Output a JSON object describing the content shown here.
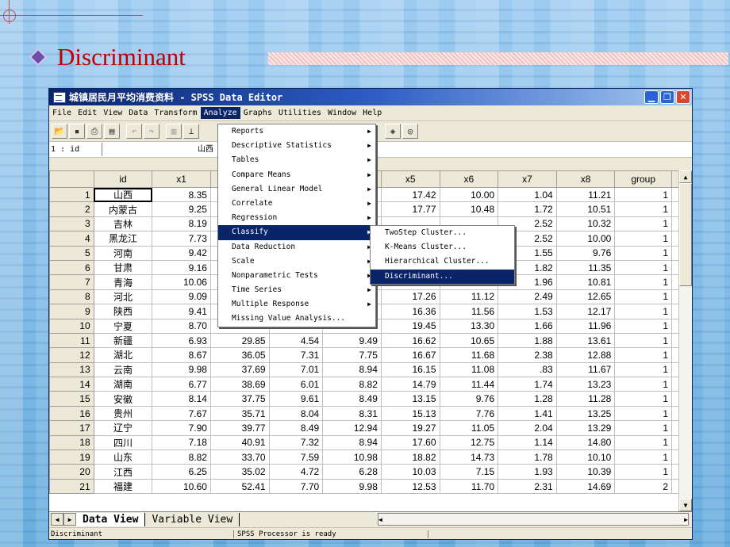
{
  "slide": {
    "title": "Discriminant"
  },
  "window": {
    "title": "城镇居民月平均消费资料 - SPSS Data Editor",
    "buttons": {
      "minimize": "▁",
      "maximize": "❐",
      "close": "✕"
    }
  },
  "menubar": [
    "File",
    "Edit",
    "View",
    "Data",
    "Transform",
    "Analyze",
    "Graphs",
    "Utilities",
    "Window",
    "Help"
  ],
  "cell_ref": {
    "address": "1 : id",
    "value": "山西"
  },
  "columns": [
    "id",
    "x1",
    "x2",
    "x3",
    "x4",
    "x5",
    "x6",
    "x7",
    "x8",
    "group"
  ],
  "rows": [
    {
      "n": "1",
      "id": "山西",
      "x1": "8.35",
      "x2": "",
      "x3": "",
      "x4": "",
      "x5": "17.42",
      "x6": "10.00",
      "x7": "1.04",
      "x8": "11.21",
      "group": "1"
    },
    {
      "n": "2",
      "id": "内蒙古",
      "x1": "9.25",
      "x2": "",
      "x3": "",
      "x4": "",
      "x5": "17.77",
      "x6": "10.48",
      "x7": "1.72",
      "x8": "10.51",
      "group": "1"
    },
    {
      "n": "3",
      "id": "吉林",
      "x1": "8.19",
      "x2": "",
      "x3": "",
      "x4": "",
      "x5": "",
      "x6": "",
      "x7": "2.52",
      "x8": "10.32",
      "group": "1"
    },
    {
      "n": "4",
      "id": "黑龙江",
      "x1": "7.73",
      "x2": "",
      "x3": "",
      "x4": "",
      "x5": "",
      "x6": "",
      "x7": "2.52",
      "x8": "10.00",
      "group": "1"
    },
    {
      "n": "5",
      "id": "河南",
      "x1": "9.42",
      "x2": "",
      "x3": "",
      "x4": "",
      "x5": "",
      "x6": "",
      "x7": "1.55",
      "x8": "9.76",
      "group": "1"
    },
    {
      "n": "6",
      "id": "甘肃",
      "x1": "9.16",
      "x2": "",
      "x3": "",
      "x4": "",
      "x5": "",
      "x6": "",
      "x7": "1.82",
      "x8": "11.35",
      "group": "1"
    },
    {
      "n": "7",
      "id": "青海",
      "x1": "10.06",
      "x2": "",
      "x3": "",
      "x4": "",
      "x5": "",
      "x6": "",
      "x7": "1.96",
      "x8": "10.81",
      "group": "1"
    },
    {
      "n": "8",
      "id": "河北",
      "x1": "9.09",
      "x2": "",
      "x3": "",
      "x4": "",
      "x5": "17.26",
      "x6": "11.12",
      "x7": "2.49",
      "x8": "12.65",
      "group": "1"
    },
    {
      "n": "9",
      "id": "陕西",
      "x1": "9.41",
      "x2": "",
      "x3": "",
      "x4": "",
      "x5": "16.36",
      "x6": "11.56",
      "x7": "1.53",
      "x8": "12.17",
      "group": "1"
    },
    {
      "n": "10",
      "id": "宁夏",
      "x1": "8.70",
      "x2": "",
      "x3": "",
      "x4": "",
      "x5": "19.45",
      "x6": "13.30",
      "x7": "1.66",
      "x8": "11.96",
      "group": "1"
    },
    {
      "n": "11",
      "id": "新疆",
      "x1": "6.93",
      "x2": "29.85",
      "x3": "4.54",
      "x4": "9.49",
      "x5": "16.62",
      "x6": "10.65",
      "x7": "1.88",
      "x8": "13.61",
      "group": "1"
    },
    {
      "n": "12",
      "id": "湖北",
      "x1": "8.67",
      "x2": "36.05",
      "x3": "7.31",
      "x4": "7.75",
      "x5": "16.67",
      "x6": "11.68",
      "x7": "2.38",
      "x8": "12.88",
      "group": "1"
    },
    {
      "n": "13",
      "id": "云南",
      "x1": "9.98",
      "x2": "37.69",
      "x3": "7.01",
      "x4": "8.94",
      "x5": "16.15",
      "x6": "11.08",
      "x7": ".83",
      "x8": "11.67",
      "group": "1"
    },
    {
      "n": "14",
      "id": "湖南",
      "x1": "6.77",
      "x2": "38.69",
      "x3": "6.01",
      "x4": "8.82",
      "x5": "14.79",
      "x6": "11.44",
      "x7": "1.74",
      "x8": "13.23",
      "group": "1"
    },
    {
      "n": "15",
      "id": "安徽",
      "x1": "8.14",
      "x2": "37.75",
      "x3": "9.61",
      "x4": "8.49",
      "x5": "13.15",
      "x6": "9.76",
      "x7": "1.28",
      "x8": "11.28",
      "group": "1"
    },
    {
      "n": "16",
      "id": "贵州",
      "x1": "7.67",
      "x2": "35.71",
      "x3": "8.04",
      "x4": "8.31",
      "x5": "15.13",
      "x6": "7.76",
      "x7": "1.41",
      "x8": "13.25",
      "group": "1"
    },
    {
      "n": "17",
      "id": "辽宁",
      "x1": "7.90",
      "x2": "39.77",
      "x3": "8.49",
      "x4": "12.94",
      "x5": "19.27",
      "x6": "11.05",
      "x7": "2.04",
      "x8": "13.29",
      "group": "1"
    },
    {
      "n": "18",
      "id": "四川",
      "x1": "7.18",
      "x2": "40.91",
      "x3": "7.32",
      "x4": "8.94",
      "x5": "17.60",
      "x6": "12.75",
      "x7": "1.14",
      "x8": "14.80",
      "group": "1"
    },
    {
      "n": "19",
      "id": "山东",
      "x1": "8.82",
      "x2": "33.70",
      "x3": "7.59",
      "x4": "10.98",
      "x5": "18.82",
      "x6": "14.73",
      "x7": "1.78",
      "x8": "10.10",
      "group": "1"
    },
    {
      "n": "20",
      "id": "江西",
      "x1": "6.25",
      "x2": "35.02",
      "x3": "4.72",
      "x4": "6.28",
      "x5": "10.03",
      "x6": "7.15",
      "x7": "1.93",
      "x8": "10.39",
      "group": "1"
    },
    {
      "n": "21",
      "id": "福建",
      "x1": "10.60",
      "x2": "52.41",
      "x3": "7.70",
      "x4": "9.98",
      "x5": "12.53",
      "x6": "11.70",
      "x7": "2.31",
      "x8": "14.69",
      "group": "2"
    }
  ],
  "analyze_menu": [
    {
      "label": "Reports",
      "sub": true
    },
    {
      "label": "Descriptive Statistics",
      "sub": true
    },
    {
      "label": "Tables",
      "sub": true
    },
    {
      "label": "Compare Means",
      "sub": true
    },
    {
      "label": "General Linear Model",
      "sub": true
    },
    {
      "label": "Correlate",
      "sub": true
    },
    {
      "label": "Regression",
      "sub": true
    },
    {
      "label": "Classify",
      "sub": true,
      "highlighted": true
    },
    {
      "label": "Data Reduction",
      "sub": true
    },
    {
      "label": "Scale",
      "sub": true
    },
    {
      "label": "Nonparametric Tests",
      "sub": true
    },
    {
      "label": "Time Series",
      "sub": true
    },
    {
      "label": "Multiple Response",
      "sub": true
    },
    {
      "label": "Missing Value Analysis...",
      "sub": false
    }
  ],
  "classify_menu": [
    {
      "label": "TwoStep Cluster..."
    },
    {
      "label": "K-Means Cluster..."
    },
    {
      "label": "Hierarchical Cluster..."
    },
    {
      "label": "Discriminant...",
      "highlighted": true
    }
  ],
  "tabs": {
    "data_view": "Data View",
    "variable_view": "Variable View"
  },
  "status": {
    "left": "Discriminant",
    "middle": "SPSS Processor  is ready"
  }
}
